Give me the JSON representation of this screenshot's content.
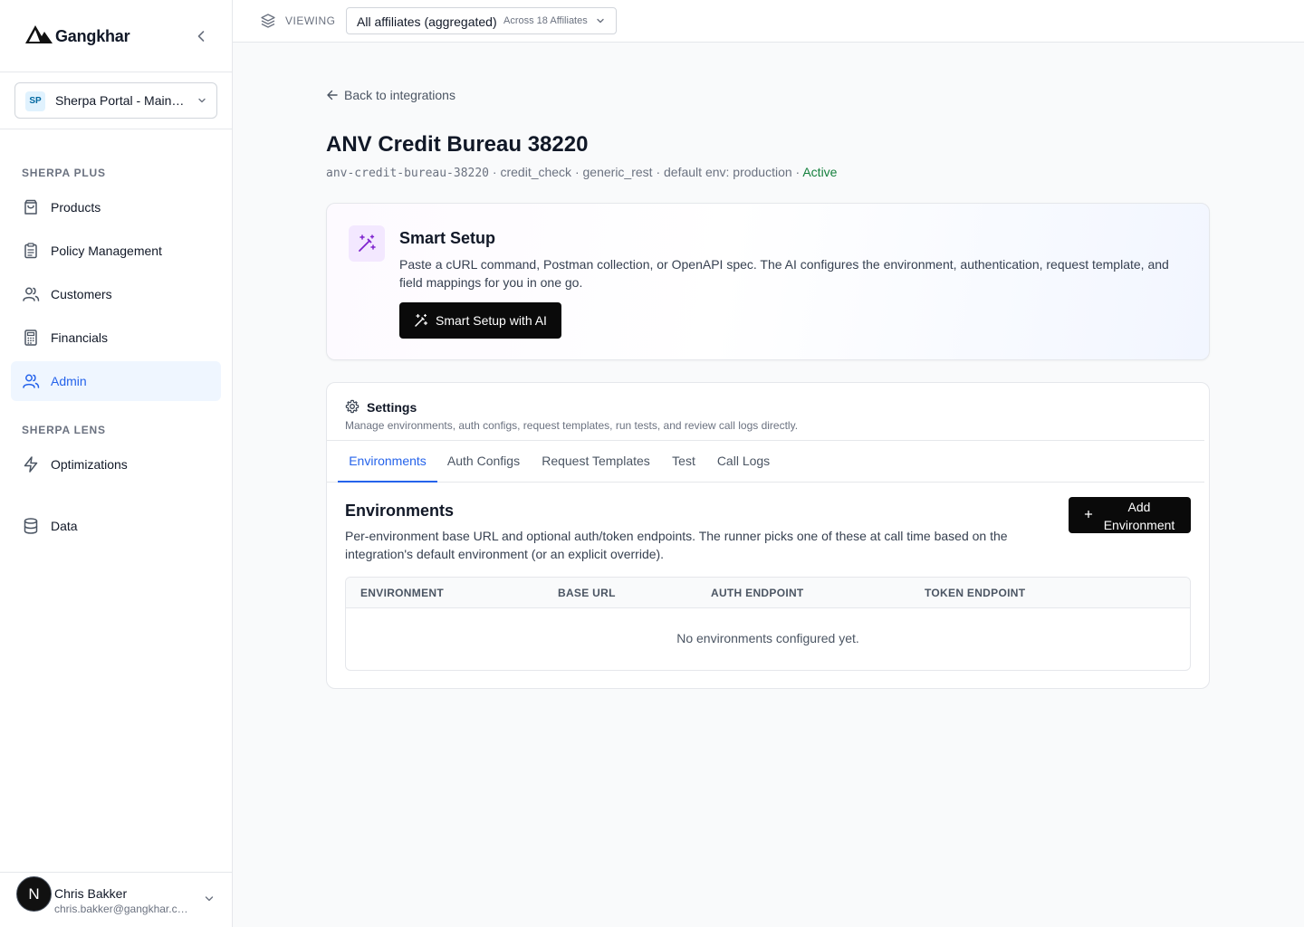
{
  "brand": {
    "name": "Gangkhar"
  },
  "portal": {
    "badge": "SP",
    "name": "Sherpa Portal - Main…"
  },
  "sidebar": {
    "sections": [
      {
        "label": "SHERPA PLUS"
      },
      {
        "label": "SHERPA LENS"
      }
    ],
    "items": [
      {
        "label": "Products",
        "icon": "shopping-bag-icon"
      },
      {
        "label": "Policy Management",
        "icon": "clipboard-icon"
      },
      {
        "label": "Customers",
        "icon": "users-icon"
      },
      {
        "label": "Financials",
        "icon": "calculator-icon"
      },
      {
        "label": "Admin",
        "icon": "users-icon",
        "active": true
      },
      {
        "label": "Optimizations",
        "icon": "lightning-icon"
      },
      {
        "label": "Data",
        "icon": "database-icon"
      }
    ]
  },
  "user": {
    "initial": "N",
    "name": "Chris Bakker",
    "email": "chris.bakker@gangkhar.c…"
  },
  "topbar": {
    "viewing_label": "VIEWING",
    "affiliate_value": "All affiliates (aggregated)",
    "affiliate_count": "Across 18 Affiliates"
  },
  "main": {
    "back_link": "Back to integrations",
    "title": "ANV Credit Bureau 38220",
    "meta": {
      "slug": "anv-credit-bureau-38220",
      "type": "credit_check",
      "adapter": "generic_rest",
      "default_env": "default env: production",
      "status": "Active",
      "sep": " · "
    }
  },
  "smart_setup": {
    "title": "Smart Setup",
    "description": "Paste a cURL command, Postman collection, or OpenAPI spec. The AI configures the environment, authentication, request template, and field mappings for you in one go.",
    "button": "Smart Setup with AI"
  },
  "settings": {
    "title": "Settings",
    "description": "Manage environments, auth configs, request templates, run tests, and review call logs directly.",
    "tabs": [
      {
        "label": "Environments",
        "active": true
      },
      {
        "label": "Auth Configs"
      },
      {
        "label": "Request Templates"
      },
      {
        "label": "Test"
      },
      {
        "label": "Call Logs"
      }
    ]
  },
  "environments": {
    "title": "Environments",
    "description": "Per-environment base URL and optional auth/token endpoints. The runner picks one of these at call time based on the integration's default environment (or an explicit override).",
    "add_button": "Add Environment",
    "columns": [
      "ENVIRONMENT",
      "BASE URL",
      "AUTH ENDPOINT",
      "TOKEN ENDPOINT"
    ],
    "rows": [],
    "empty_message": "No environments configured yet."
  },
  "colors": {
    "accent": "#2563eb",
    "active_bg": "#eff6ff",
    "status_active": "#15803d",
    "smart_icon": "#7e22ce"
  }
}
